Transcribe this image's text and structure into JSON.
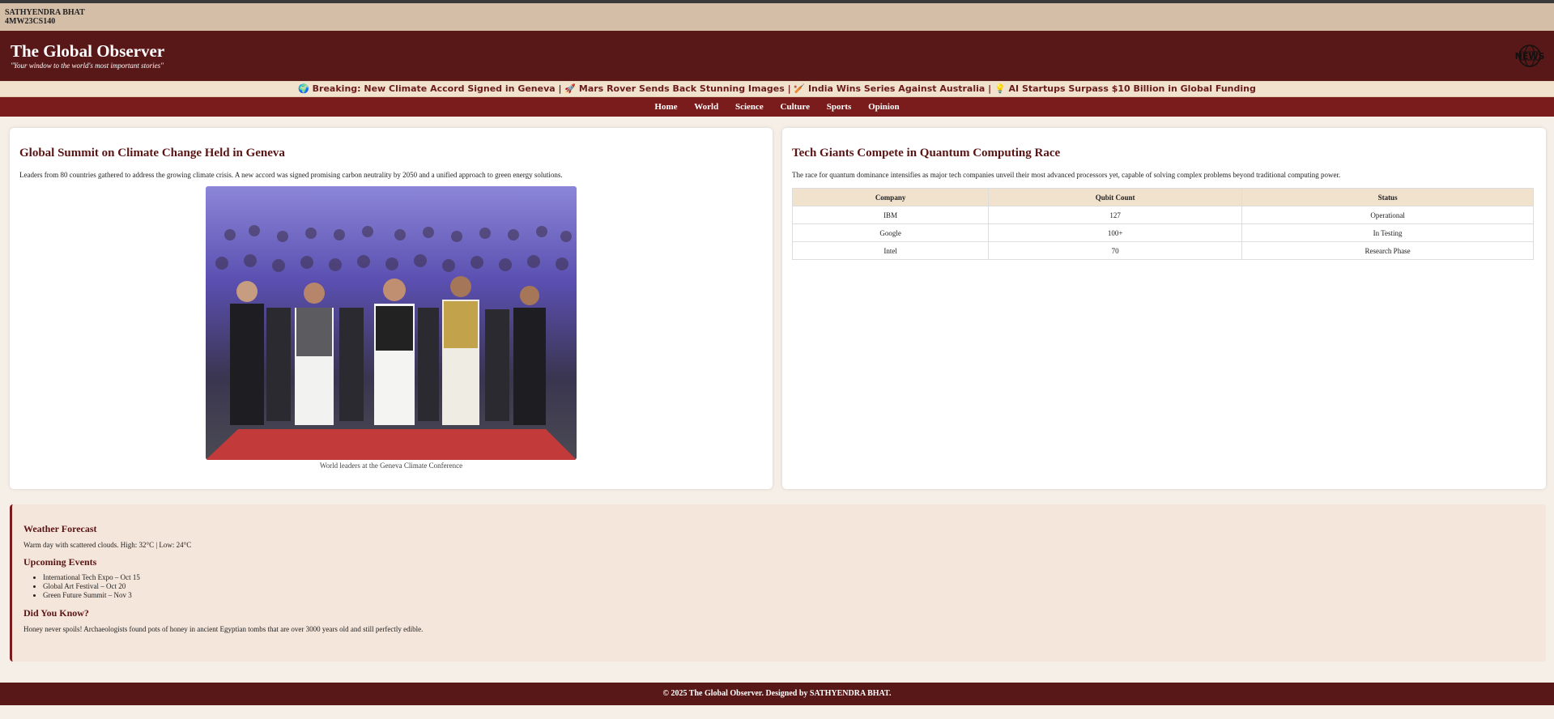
{
  "student": {
    "name": "SATHYENDRA BHAT",
    "id": "4MW23CS140"
  },
  "masthead": {
    "title": "The Global Observer",
    "tagline": "\"Your window to the world's most important stories\"",
    "logo_text": "NEWS"
  },
  "ticker": {
    "text": "🌍 Breaking: New Climate Accord Signed in Geneva | 🚀 Mars Rover Sends Back Stunning Images | 🏏 India Wins Series Against Australia | 💡 AI Startups Surpass $10 Billion in Global Funding"
  },
  "nav": {
    "items": [
      "Home",
      "World",
      "Science",
      "Culture",
      "Sports",
      "Opinion"
    ]
  },
  "article_left": {
    "headline": "Global Summit on Climate Change Held in Geneva",
    "body": "Leaders from 80 countries gathered to address the growing climate crisis. A new accord was signed promising carbon neutrality by 2050 and a unified approach to green energy solutions.",
    "caption": "World leaders at the Geneva Climate Conference"
  },
  "article_right": {
    "headline": "Tech Giants Compete in Quantum Computing Race",
    "body": "The race for quantum dominance intensifies as major tech companies unveil their most advanced processors yet, capable of solving complex problems beyond traditional computing power.",
    "table": {
      "headers": [
        "Company",
        "Qubit Count",
        "Status"
      ],
      "rows": [
        [
          "IBM",
          "127",
          "Operational"
        ],
        [
          "Google",
          "100+",
          "In Testing"
        ],
        [
          "Intel",
          "70",
          "Research Phase"
        ]
      ]
    }
  },
  "info": {
    "weather_title": "Weather Forecast",
    "weather_text": "Warm day with scattered clouds. High: 32°C | Low: 24°C",
    "events_title": "Upcoming Events",
    "events": [
      "International Tech Expo – Oct 15",
      "Global Art Festival – Oct 20",
      "Green Future Summit – Nov 3"
    ],
    "fact_title": "Did You Know?",
    "fact_text": "Honey never spoils! Archaeologists found pots of honey in ancient Egyptian tombs that are over 3000 years old and still perfectly edible."
  },
  "footer": {
    "text": "© 2025 The Global Observer. Designed by SATHYENDRA BHAT."
  },
  "colors": {
    "masthead": "#581818",
    "nav": "#7a1c1c",
    "ticker_bg": "#f1e2cd",
    "info_bg": "#f5e6db"
  }
}
